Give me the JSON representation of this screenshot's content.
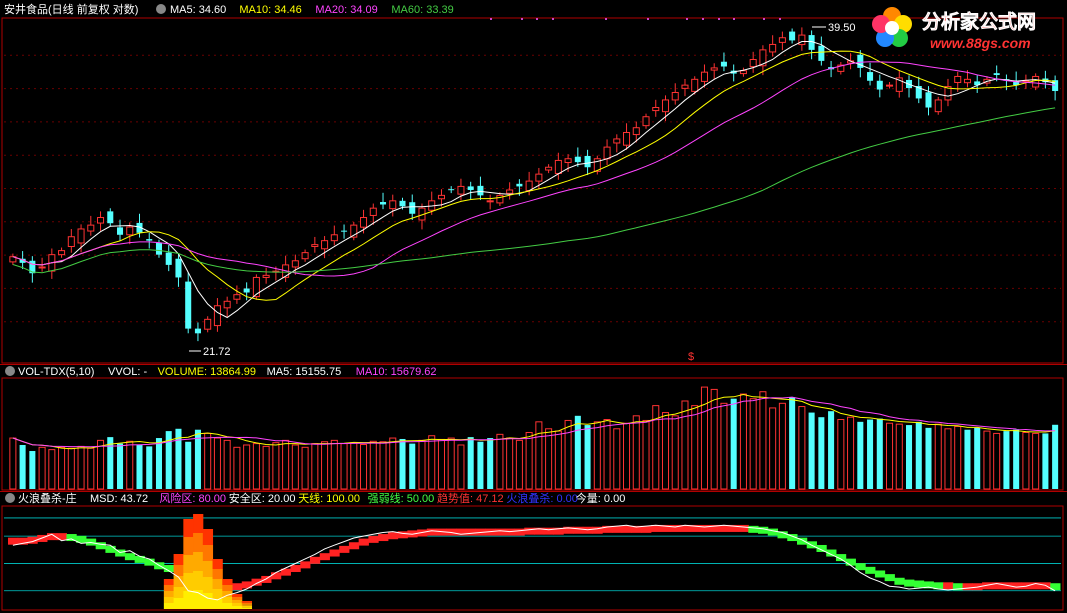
{
  "price_panel": {
    "title": "安井食品(日线 前复权 对数)",
    "legend": [
      {
        "label": "MA5:",
        "value": "34.60",
        "color": "#ffffff"
      },
      {
        "label": "MA10:",
        "value": "34.46",
        "color": "#ffff00"
      },
      {
        "label": "MA20:",
        "value": "34.09",
        "color": "#ff44ff"
      },
      {
        "label": "MA60:",
        "value": "33.39",
        "color": "#44cc44"
      }
    ],
    "high_label": "39.50",
    "low_label": "21.72",
    "signal_label": "$"
  },
  "volume_panel": {
    "title": "VOL-TDX(5,10)",
    "legend": [
      {
        "label": "VVOL:",
        "value": "-",
        "color": "#ffffff"
      },
      {
        "label": "VOLUME:",
        "value": "13864.99",
        "color": "#ffff00"
      },
      {
        "label": "MA5:",
        "value": "15155.75",
        "color": "#ffffff"
      },
      {
        "label": "MA10:",
        "value": "15679.62",
        "color": "#ff44ff"
      }
    ]
  },
  "indicator_panel": {
    "title": "火浪叠杀-庄",
    "legend": [
      {
        "label": "MSD:",
        "value": "43.72",
        "color": "#ffffff"
      },
      {
        "label": "风险区:",
        "value": "80.00",
        "color": "#ff44ff"
      },
      {
        "label": "安全区:",
        "value": "20.00",
        "color": "#ffffff"
      },
      {
        "label": "天线:",
        "value": "100.00",
        "color": "#ffff00"
      },
      {
        "label": "强弱线:",
        "value": "50.00",
        "color": "#44ff44"
      },
      {
        "label": "趋势值:",
        "value": "47.12",
        "color": "#ff3333"
      },
      {
        "label": "火浪叠杀:",
        "value": "0.00",
        "color": "#3333ff"
      },
      {
        "label": "今量:",
        "value": "0.00",
        "color": "#ffffff"
      }
    ]
  },
  "watermark": {
    "brand": "分析家公式网",
    "url": "www.88gs.com"
  },
  "colors": {
    "up": "#ff3333",
    "down": "#54ffff",
    "ma5": "#ffffff",
    "ma10": "#ffff00",
    "ma20": "#ff44ff",
    "ma60": "#44cc44",
    "frame": "#b00000"
  },
  "chart_data": [
    {
      "type": "candlestick",
      "title": "安井食品(日线 前复权 对数)",
      "ylim": [
        21,
        40
      ],
      "log_scale": true,
      "annotations": [
        "39.50",
        "21.72"
      ],
      "close": [
        25.4,
        25.1,
        24.6,
        24.9,
        25.5,
        25.7,
        26.4,
        26.8,
        27.0,
        27.4,
        27.1,
        26.5,
        26.9,
        26.6,
        26.2,
        25.5,
        25.0,
        24.4,
        22.1,
        21.9,
        22.5,
        23.1,
        23.3,
        23.6,
        23.7,
        24.4,
        24.5,
        24.7,
        25.0,
        25.2,
        25.6,
        26.0,
        26.2,
        26.5,
        26.7,
        27.0,
        27.4,
        27.9,
        28.1,
        28.3,
        28.0,
        27.6,
        27.9,
        28.3,
        28.6,
        28.9,
        29.1,
        28.9,
        28.6,
        28.3,
        28.6,
        28.9,
        29.1,
        29.4,
        29.8,
        30.2,
        30.6,
        30.7,
        30.5,
        30.2,
        30.7,
        31.4,
        31.9,
        32.3,
        32.6,
        33.3,
        33.9,
        34.4,
        34.9,
        35.4,
        35.8,
        36.3,
        36.6,
        36.7,
        36.2,
        36.4,
        37.2,
        37.9,
        38.3,
        38.8,
        38.6,
        39.0,
        37.9,
        37.1,
        36.5,
        36.8,
        37.1,
        36.6,
        35.7,
        35.1,
        35.4,
        35.9,
        35.2,
        34.5,
        33.9,
        34.4,
        35.3,
        36.0,
        35.8,
        35.4,
        35.8,
        36.1,
        35.7,
        35.4,
        35.7,
        36.0,
        35.6,
        35.0
      ]
    },
    {
      "type": "bar",
      "title": "VOL-TDX(5,10)",
      "values": [
        11000,
        9500,
        8200,
        9000,
        8500,
        9000,
        8800,
        9200,
        8800,
        10500,
        11200,
        9800,
        10300,
        9500,
        9200,
        11000,
        12500,
        13000,
        10200,
        12800,
        12000,
        11000,
        10500,
        9000,
        9500,
        9800,
        9200,
        10000,
        10500,
        9500,
        9000,
        9800,
        10200,
        10500,
        9800,
        10000,
        9600,
        10300,
        10200,
        11000,
        10800,
        9800,
        10500,
        11500,
        10700,
        11000,
        9500,
        11200,
        10200,
        11000,
        11800,
        11000,
        10500,
        12200,
        14500,
        13000,
        12500,
        14800,
        15800,
        13800,
        14500,
        15000,
        13000,
        14200,
        15800,
        14800,
        18000,
        16500,
        15800,
        19000,
        18000,
        22000,
        21500,
        18500,
        19500,
        20500,
        19500,
        21000,
        17500,
        18500,
        19800,
        17800,
        16500,
        15500,
        16800,
        15000,
        15500,
        14500,
        15000,
        15200,
        14200,
        14000,
        13800,
        14500,
        13200,
        14000,
        13000,
        13500,
        12800,
        13200,
        12500,
        12000,
        12500,
        12800,
        12200,
        12000,
        12000,
        13864
      ]
    },
    {
      "type": "line",
      "title": "火浪叠杀-庄",
      "series": [
        {
          "name": "MSD",
          "values": [
            70,
            72,
            74,
            78,
            82,
            75,
            77,
            72,
            73,
            71,
            70,
            62,
            64,
            58,
            55,
            48,
            42,
            35,
            20,
            18,
            12,
            10,
            15,
            18,
            22,
            28,
            33,
            40,
            45,
            50,
            55,
            60,
            66,
            70,
            74,
            78,
            80,
            82,
            84,
            85,
            83,
            82,
            84,
            86,
            85,
            84,
            82,
            83,
            84,
            85,
            86,
            85,
            86,
            87,
            88,
            87,
            88,
            89,
            88,
            87,
            88,
            90,
            91,
            92,
            90,
            91,
            92,
            91,
            90,
            92,
            91,
            90,
            91,
            92,
            91,
            90,
            89,
            88,
            86,
            84,
            80,
            76,
            70,
            65,
            60,
            55,
            48,
            40,
            34,
            30,
            25,
            24,
            22,
            23,
            24,
            22,
            21,
            22,
            23,
            24,
            26,
            28,
            26,
            24,
            25,
            28,
            26,
            20
          ]
        },
        {
          "name": "趋势值",
          "values": [
            75,
            75,
            76,
            78,
            80,
            80,
            79,
            77,
            74,
            70,
            66,
            62,
            58,
            55,
            52,
            48,
            45,
            40,
            36,
            32,
            28,
            25,
            24,
            25,
            27,
            30,
            33,
            37,
            41,
            45,
            49,
            54,
            58,
            62,
            66,
            70,
            74,
            77,
            79,
            81,
            82,
            83,
            84,
            85,
            85,
            85,
            85,
            85,
            85,
            85,
            85,
            85,
            85,
            86,
            86,
            86,
            86,
            87,
            87,
            87,
            87,
            88,
            88,
            88,
            88,
            88,
            89,
            89,
            89,
            89,
            89,
            89,
            89,
            89,
            89,
            89,
            88,
            87,
            85,
            82,
            79,
            75,
            71,
            67,
            62,
            57,
            52,
            47,
            43,
            39,
            35,
            31,
            29,
            28,
            27,
            26,
            26,
            25,
            25,
            25,
            26,
            26,
            26,
            26,
            26,
            26,
            26,
            25
          ]
        }
      ],
      "risk_zone": 80,
      "safe_zone": 20,
      "antenna": 100,
      "strength_line": 50
    }
  ]
}
